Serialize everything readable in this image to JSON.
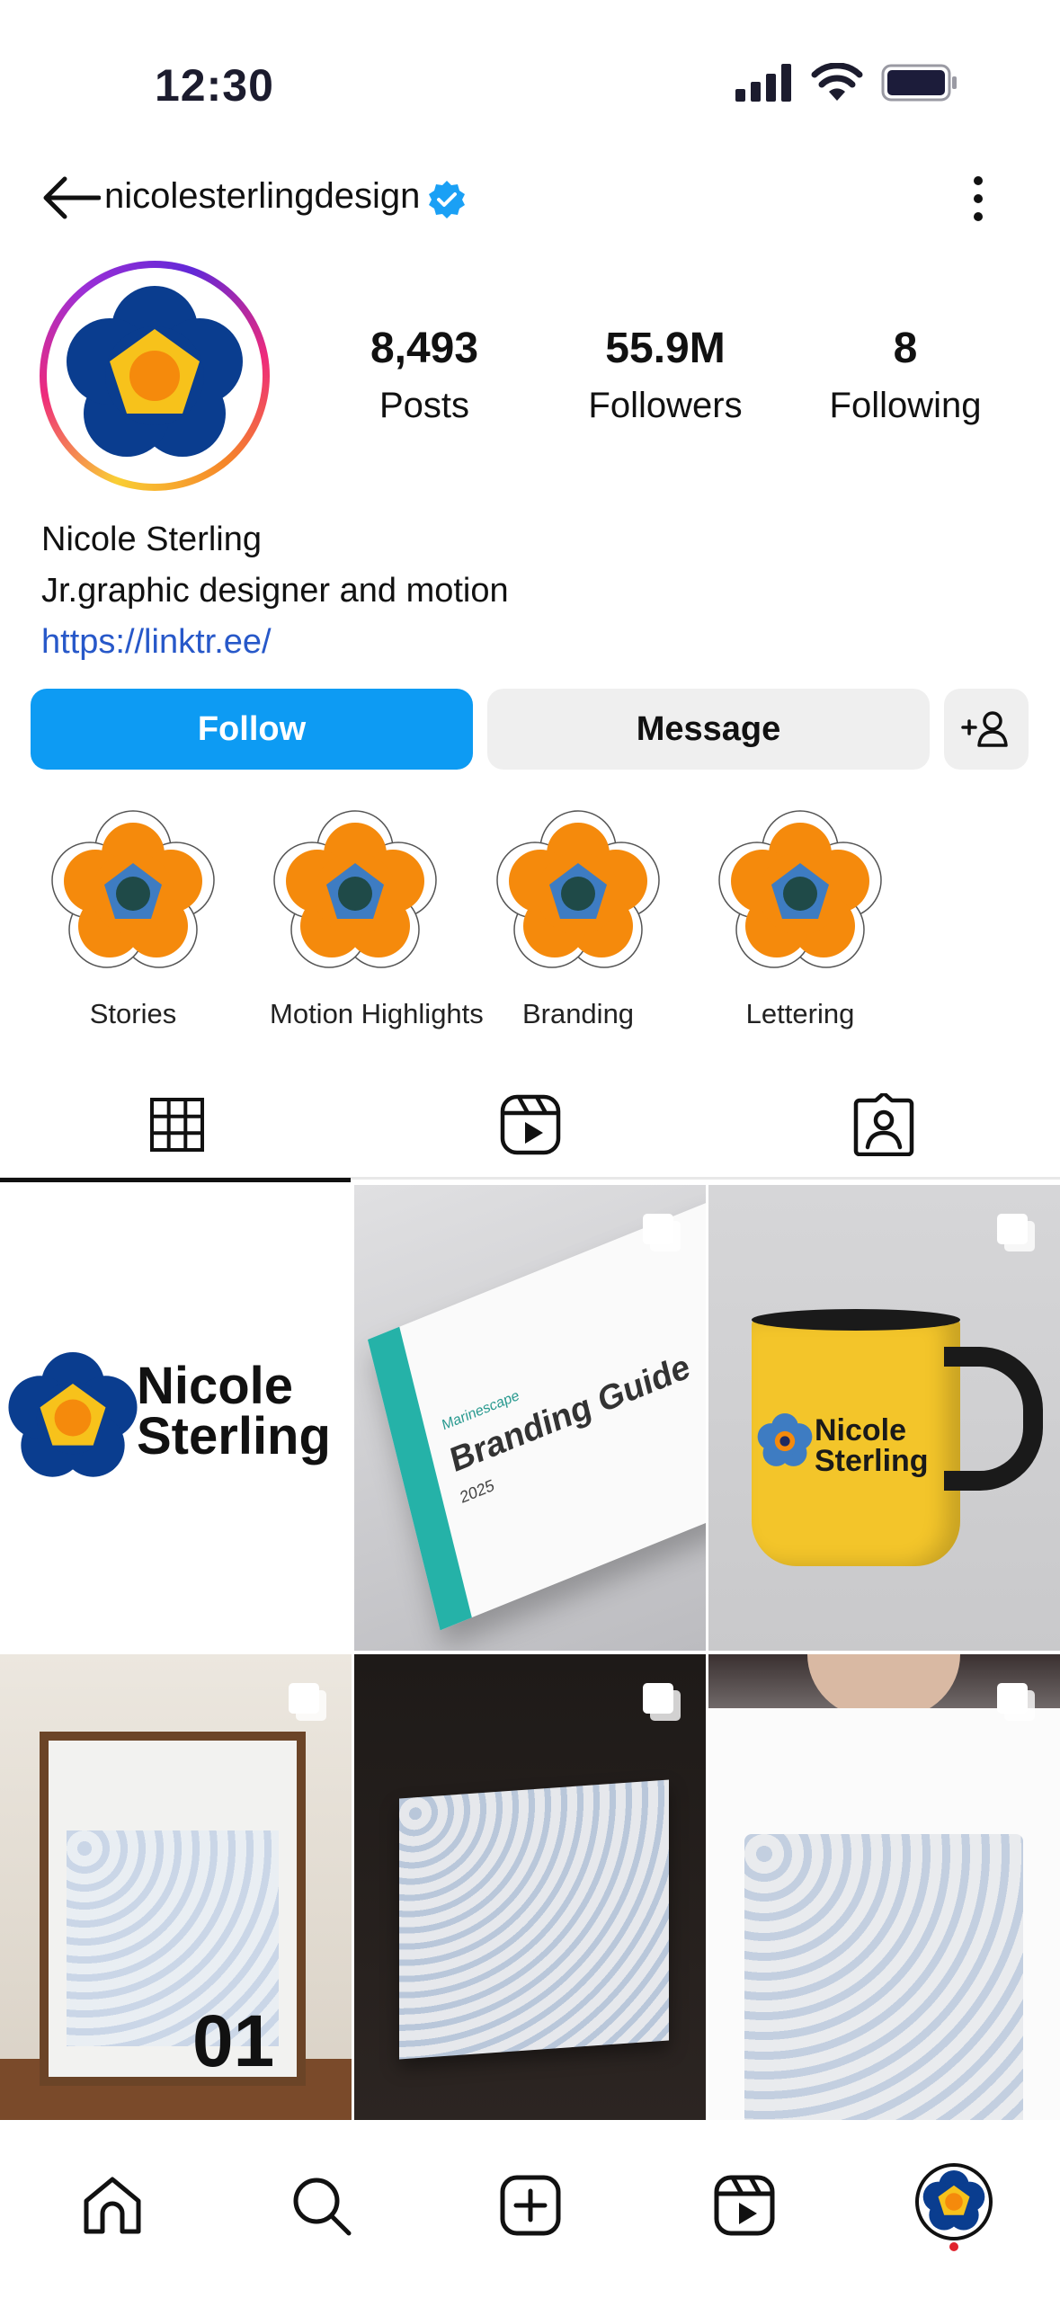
{
  "status_bar": {
    "time": "12:30"
  },
  "header": {
    "username": "nicolesterlingdesign"
  },
  "profile": {
    "stats": [
      {
        "value": "8,493",
        "label": "Posts"
      },
      {
        "value": "55.9M",
        "label": "Followers"
      },
      {
        "value": "8",
        "label": "Following"
      }
    ],
    "name": "Nicole Sterling",
    "bio": "Jr.graphic designer and motion",
    "link": "https://linktr.ee/"
  },
  "actions": {
    "follow": "Follow",
    "message": "Message"
  },
  "highlights": [
    {
      "label": "Stories"
    },
    {
      "label": "Motion Highlights"
    },
    {
      "label": "Branding"
    },
    {
      "label": "Lettering"
    }
  ],
  "posts": {
    "logo_text": [
      "Nicole",
      "Sterling"
    ],
    "book_title": "Branding Guide",
    "book_year": "2025",
    "book_brand": "Marinescape",
    "mug_text": [
      "Nicole",
      "Sterling"
    ],
    "poster_number": "01"
  },
  "colors": {
    "accent_blue": "#0d9bf3",
    "link_blue": "#2758c9",
    "flower_navy": "#0a3d8f",
    "flower_yellow": "#f7c21b",
    "flower_orange": "#f58a0c",
    "notification_red": "#e0232e"
  }
}
